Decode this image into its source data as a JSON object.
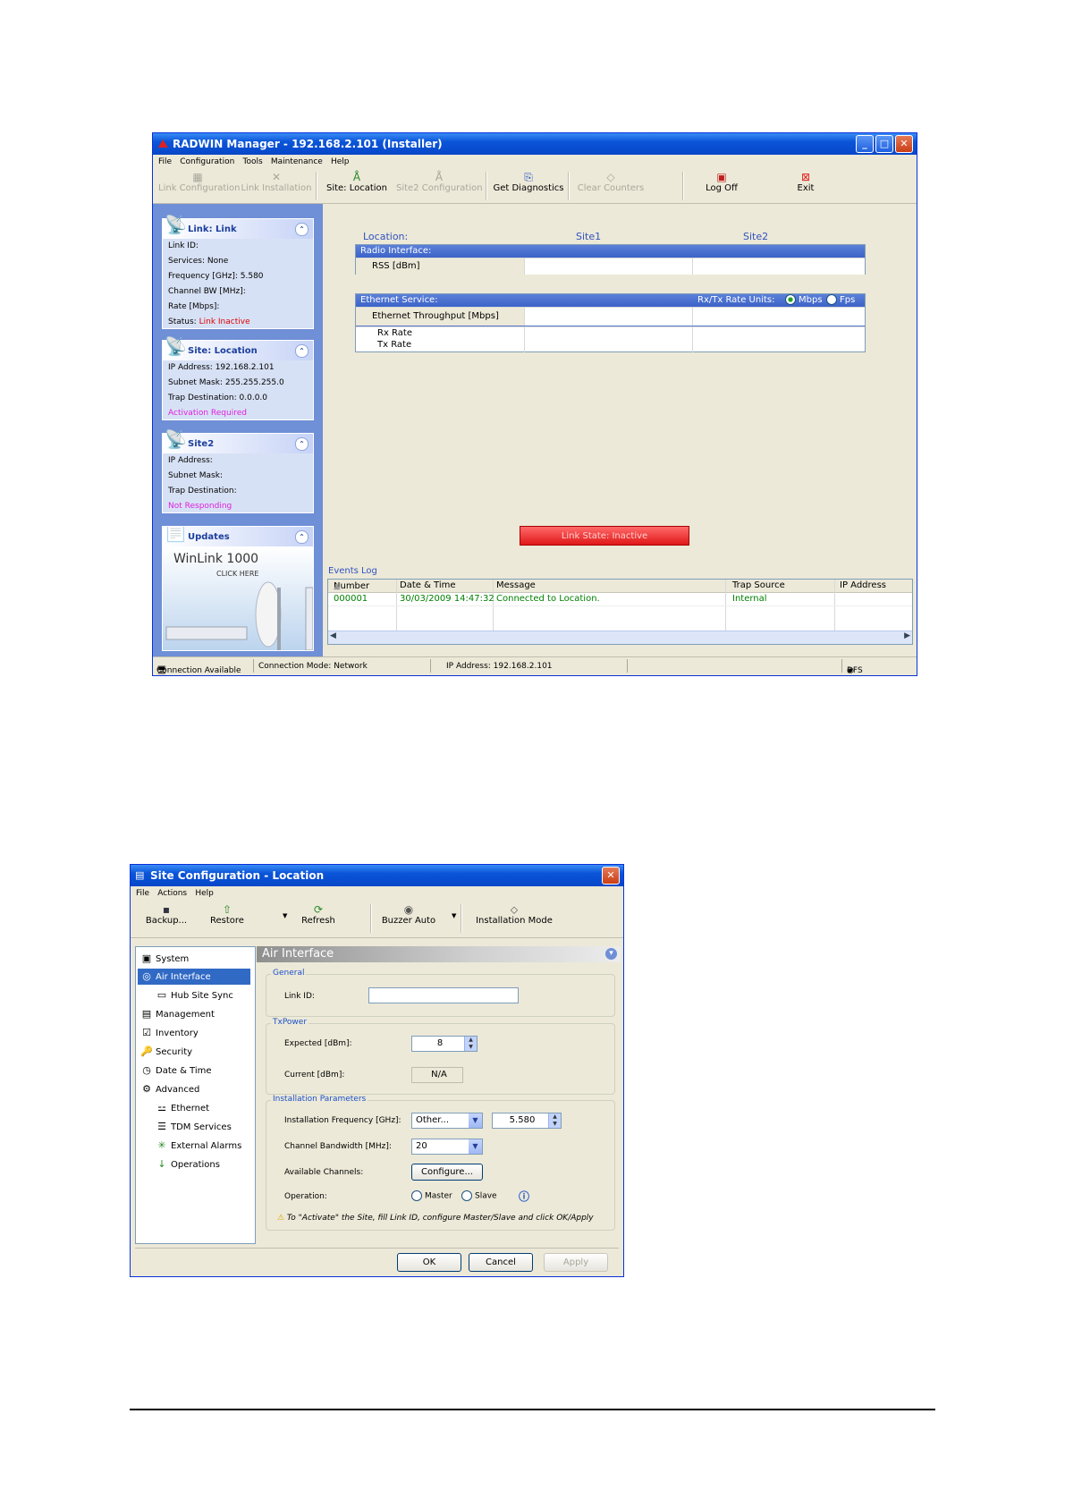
{
  "manager": {
    "title": "RADWIN Manager - 192.168.2.101 (Installer)",
    "menu": [
      "File",
      "Configuration",
      "Tools",
      "Maintenance",
      "Help"
    ],
    "toolbar": [
      {
        "label": "Link Configuration",
        "icon": "link-config-icon",
        "enabled": false
      },
      {
        "label": "Link Installation",
        "icon": "tools-icon",
        "enabled": false
      },
      {
        "label": "Site: Location",
        "icon": "site-icon",
        "enabled": true
      },
      {
        "label": "Site2 Configuration",
        "icon": "site-icon",
        "enabled": false
      },
      {
        "label": "Get Diagnostics",
        "icon": "diagnostics-icon",
        "enabled": true
      },
      {
        "label": "Clear Counters",
        "icon": "eraser-icon",
        "enabled": false
      },
      {
        "label": "Log Off",
        "icon": "logoff-icon",
        "enabled": true
      },
      {
        "label": "Exit",
        "icon": "exit-icon",
        "enabled": true
      }
    ],
    "link_panel": {
      "title": "Link: Link",
      "rows": {
        "link_id": "Link ID:",
        "services_label": "Services:",
        "services_value": "None",
        "freq_label": "Frequency [GHz]:",
        "freq_value": "5.580",
        "bw_label": "Channel BW [MHz]:",
        "rate_label": "Rate [Mbps]:",
        "status_label": "Status:",
        "status_value": "Link Inactive"
      }
    },
    "site_panel": {
      "title": "Site: Location",
      "ip_label": "IP Address:",
      "ip_value": "192.168.2.101",
      "mask_label": "Subnet Mask:",
      "mask_value": "255.255.255.0",
      "trap_label": "Trap Destination:",
      "trap_value": "0.0.0.0",
      "note": "Activation Required"
    },
    "site2_panel": {
      "title": "Site2",
      "ip_label": "IP Address:",
      "mask_label": "Subnet Mask:",
      "trap_label": "Trap Destination:",
      "note": "Not Responding"
    },
    "updates_panel": {
      "title": "Updates",
      "banner_title": "WinLink 1000",
      "banner_sub": "CLICK HERE"
    },
    "main": {
      "location_label": "Location:",
      "site1": "Site1",
      "site2": "Site2",
      "radio_header": "Radio Interface:",
      "rss_label": "RSS [dBm]",
      "eth_header": "Ethernet Service:",
      "rate_units_label": "Rx/Tx Rate Units:",
      "unit_mbps": "Mbps",
      "unit_fps": "Fps",
      "eth_throughput": "Ethernet Throughput [Mbps]",
      "rx_rate": "Rx Rate",
      "tx_rate": "Tx Rate",
      "link_state": "Link State: Inactive"
    },
    "events": {
      "title": "Events Log",
      "columns": [
        "Number",
        "Date & Time",
        "Message",
        "Trap Source",
        "IP Address"
      ],
      "rows": [
        {
          "number": "000001",
          "datetime": "30/03/2009 14:47:32",
          "message": "Connected to Location.",
          "source": "Internal",
          "ip": ""
        }
      ]
    },
    "status": {
      "connection": "Connection Available",
      "mode": "Connection Mode: Network",
      "ip": "IP Address: 192.168.2.101",
      "dfs": "DFS"
    }
  },
  "siteconfig": {
    "title": "Site Configuration - Location",
    "menu": [
      "File",
      "Actions",
      "Help"
    ],
    "toolbar": [
      {
        "label": "Backup...",
        "icon": "floppy-icon"
      },
      {
        "label": "Restore",
        "icon": "restore-icon"
      },
      {
        "label": "Refresh",
        "icon": "refresh-icon"
      },
      {
        "label": "Buzzer Auto",
        "icon": "buzzer-icon"
      },
      {
        "label": "Installation Mode",
        "icon": "install-mode-icon"
      }
    ],
    "tree": [
      {
        "label": "System",
        "icon": "system-icon",
        "indent": 0
      },
      {
        "label": "Air Interface",
        "icon": "air-icon",
        "indent": 0,
        "selected": true
      },
      {
        "label": "Hub Site Sync",
        "icon": "sync-icon",
        "indent": 1
      },
      {
        "label": "Management",
        "icon": "management-icon",
        "indent": 0
      },
      {
        "label": "Inventory",
        "icon": "inventory-icon",
        "indent": 0
      },
      {
        "label": "Security",
        "icon": "security-icon",
        "indent": 0
      },
      {
        "label": "Date & Time",
        "icon": "clock-icon",
        "indent": 0
      },
      {
        "label": "Advanced",
        "icon": "gear-icon",
        "indent": 0
      },
      {
        "label": "Ethernet",
        "icon": "ethernet-icon",
        "indent": 1
      },
      {
        "label": "TDM Services",
        "icon": "tdm-icon",
        "indent": 1
      },
      {
        "label": "External Alarms",
        "icon": "alarm-icon",
        "indent": 1
      },
      {
        "label": "Operations",
        "icon": "operations-icon",
        "indent": 1
      }
    ],
    "panel_title": "Air Interface",
    "general": {
      "label": "General",
      "link_id_label": "Link ID:",
      "link_id_value": ""
    },
    "txpower": {
      "label": "TxPower",
      "expected_label": "Expected [dBm]:",
      "expected_value": "8",
      "current_label": "Current [dBm]:",
      "current_value": "N/A"
    },
    "install": {
      "label": "Installation Parameters",
      "freq_label": "Installation Frequency [GHz]:",
      "freq_select": "Other...",
      "freq_value": "5.580",
      "bw_label": "Channel Bandwidth [MHz]:",
      "bw_value": "20",
      "channels_label": "Available Channels:",
      "configure_button": "Configure...",
      "operation_label": "Operation:",
      "master": "Master",
      "slave": "Slave",
      "warning": "To \"Activate\" the Site, fill Link ID, configure Master/Slave and click OK/Apply"
    },
    "buttons": {
      "ok": "OK",
      "cancel": "Cancel",
      "apply": "Apply"
    }
  }
}
